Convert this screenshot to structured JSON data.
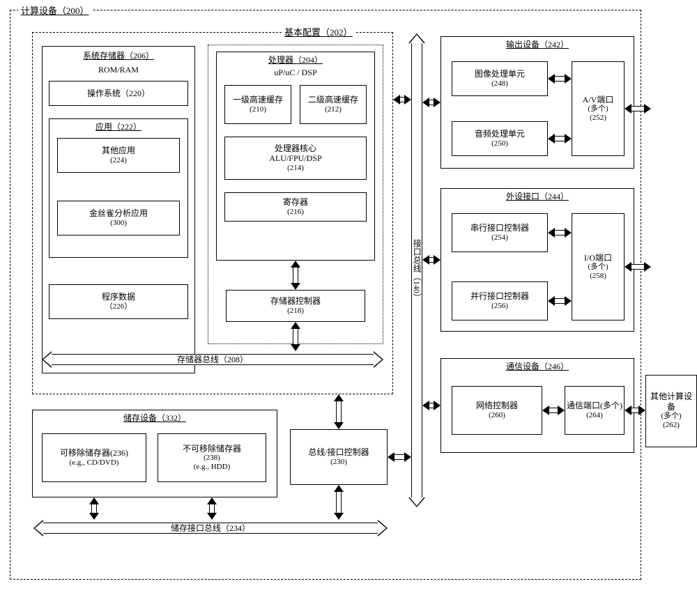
{
  "device": {
    "title": "计算设备（200）"
  },
  "basic": {
    "title": "基本配置（202）"
  },
  "sysmem": {
    "title": "系统存储器（206）",
    "rom": "ROM/RAM",
    "os": "操作系统（220）",
    "app_title": "应用（222）",
    "app_other": "其他应用",
    "app_other_num": "(224)",
    "app_canary": "金丝雀分析应用",
    "app_canary_num": "(300)",
    "progdata": "程序数据",
    "progdata_num": "（226）"
  },
  "proc": {
    "title": "处理器（204）",
    "type": "uP/uC / DSP",
    "l1": "一级高速缓存",
    "l1_num": "(210)",
    "l2": "二级高速缓存",
    "l2_num": "(212)",
    "core": "处理器核心",
    "core_type": "ALU/FPU/DSP",
    "core_num": "(214)",
    "reg": "寄存器",
    "reg_num": "(216)",
    "memctl": "存储器控制器",
    "memctl_num": "(218)"
  },
  "membus": "存储器总线（208）",
  "ifbus": "接口总线（140）",
  "storage": {
    "title": "储存设备（332）",
    "rem": "可移除储存器(236)",
    "rem_sub": "(e.g., CD/DVD)",
    "nrem": "不可移除储存器",
    "nrem_num": "(238)",
    "nrem_sub": "(e.g., HDD)",
    "bus": "储存接口总线（234）"
  },
  "busif": {
    "t": "总线/接口控制器",
    "n": "(230)"
  },
  "output": {
    "title": "输出设备（242）",
    "gpu": "图像处理单元",
    "gpu_num": "(248)",
    "apu": "音频处理单元",
    "apu_num": "(250)",
    "av": "A/V端口",
    "av_sub": "(多个)",
    "av_num": "(252)"
  },
  "periph": {
    "title": "外设接口（244）",
    "ser": "串行接口控制器",
    "ser_num": "(254)",
    "par": "并行接口控制器",
    "par_num": "(256)",
    "io": "I/O端口",
    "io_sub": "(多个)",
    "io_num": "(258)"
  },
  "comm": {
    "title": "通信设备（246）",
    "net": "网络控制器",
    "net_num": "(260)",
    "port": "通信端口(多个)",
    "port_num": "(264)"
  },
  "other": {
    "t": "其他计算设备",
    "sub": "(多个)",
    "n": "(262)"
  }
}
